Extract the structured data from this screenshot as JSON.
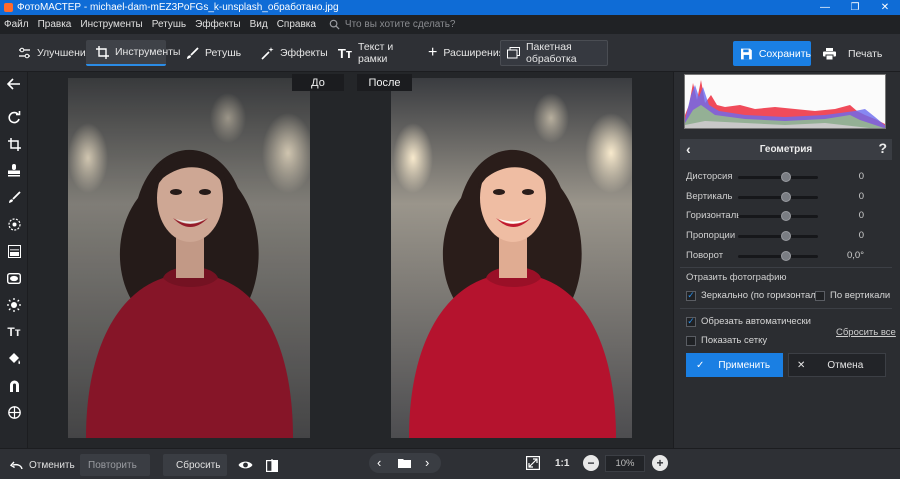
{
  "titlebar": {
    "title": "ФотоМАСТЕР - michael-dam-mEZ3PoFGs_k-unsplash_обработано.jpg",
    "minimize": "—",
    "maximize": "❐",
    "close": "✕"
  },
  "menu": {
    "items": [
      "Файл",
      "Правка",
      "Инструменты",
      "Ретушь",
      "Эффекты",
      "Вид",
      "Справка"
    ],
    "search_placeholder": "Что вы хотите сделать?"
  },
  "toolbar": {
    "tabs": [
      {
        "label": "Улучшения",
        "icon": "sliders-icon"
      },
      {
        "label": "Инструменты",
        "icon": "crop-icon",
        "active": true
      },
      {
        "label": "Ретушь",
        "icon": "brush-icon"
      },
      {
        "label": "Эффекты",
        "icon": "magic-wand-icon"
      },
      {
        "label": "Текст и рамки",
        "icon": "text-icon"
      },
      {
        "label": "Расширения",
        "icon": "plus-icon"
      }
    ],
    "batch_label": "Пакетная обработка",
    "save_label": "Сохранить",
    "print_label": "Печать"
  },
  "canvas": {
    "before_label": "До",
    "after_label": "После"
  },
  "panel": {
    "title": "Геометрия",
    "help": "?",
    "sliders": [
      {
        "label": "Дисторсия",
        "value": "0"
      },
      {
        "label": "Вертикаль",
        "value": "0"
      },
      {
        "label": "Горизонталь",
        "value": "0"
      },
      {
        "label": "Пропорции",
        "value": "0"
      },
      {
        "label": "Поворот",
        "value": "0,0°"
      }
    ],
    "flip_section": "Отразить фотографию",
    "mirror_h": "Зеркально (по горизонтали)",
    "mirror_v": "По вертикали",
    "auto_crop": "Обрезать автоматически",
    "show_grid": "Показать сетку",
    "reset_all": "Сбросить все",
    "apply": "Применить",
    "cancel": "Отмена"
  },
  "bottom": {
    "undo": "Отменить",
    "redo": "Повторить",
    "reset": "Сбросить",
    "ratio": "1:1",
    "zoom": "10%"
  },
  "colors": {
    "accent": "#1a7fe3",
    "titlebar": "#0f6cd6",
    "sweater": "#a3122a"
  }
}
